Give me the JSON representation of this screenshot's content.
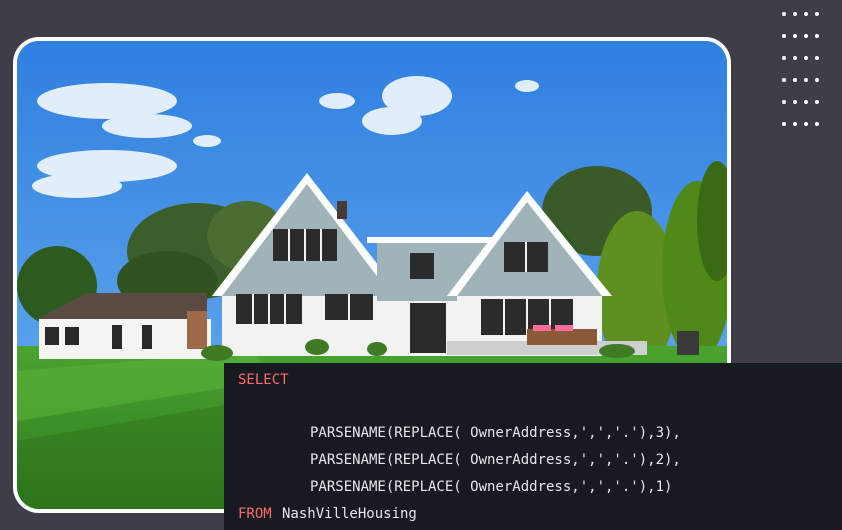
{
  "code": {
    "keyword_select": "SELECT",
    "lines": [
      "PARSENAME(REPLACE( OwnerAddress,',','.'),3),",
      "PARSENAME(REPLACE( OwnerAddress,',','.'),2),",
      "PARSENAME(REPLACE( OwnerAddress,',','.'),1)"
    ],
    "keyword_from": "FROM",
    "table_name": "NashVilleHousing"
  },
  "colors": {
    "background": "#3f3d47",
    "code_background": "#171a21",
    "keyword": "#ff6b6b",
    "code_text": "#e4e7ec",
    "frame_border": "#ffffff"
  },
  "decor": {
    "icon": "dot-grid-icon"
  }
}
